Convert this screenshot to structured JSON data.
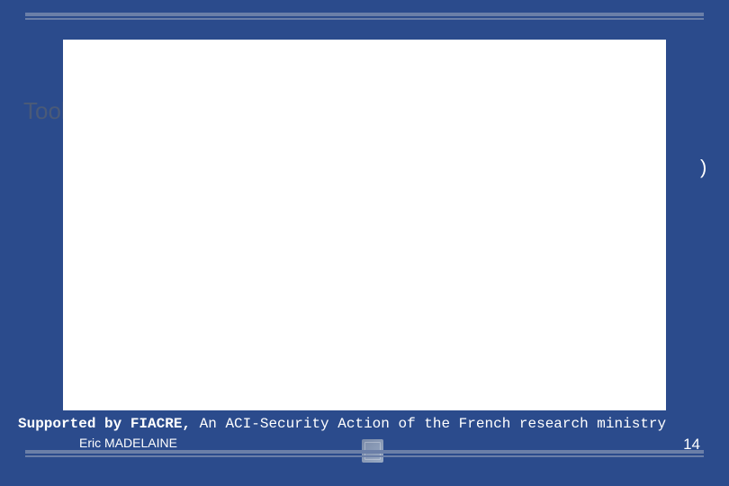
{
  "title": "Tools",
  "stray": ")",
  "support": {
    "bold": "Supported by FIACRE,",
    "rest": " An ACI-Security Action of the French research ministry"
  },
  "footer": {
    "author": "Eric MADELAINE",
    "page": "14"
  }
}
